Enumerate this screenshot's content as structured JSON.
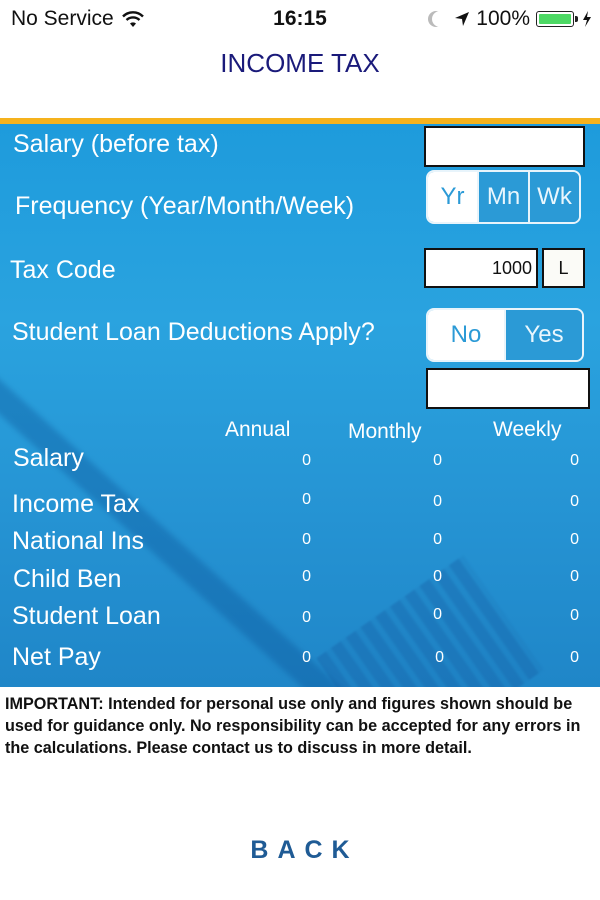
{
  "status_bar": {
    "carrier": "No Service",
    "time": "16:15",
    "battery_percent": "100%",
    "icons": [
      "wifi-icon",
      "moon-icon",
      "location-arrow-icon",
      "battery-icon",
      "charging-bolt-icon"
    ]
  },
  "header": {
    "title": "INCOME TAX"
  },
  "form": {
    "salary_label": "Salary (before tax)",
    "salary_value": "",
    "frequency_label": "Frequency (Year/Month/Week)",
    "frequency_options": [
      "Yr",
      "Mn",
      "Wk"
    ],
    "frequency_selected": "Yr",
    "tax_code_label": "Tax Code",
    "tax_code_value": "1000",
    "tax_code_suffix": "L",
    "student_loan_label": "Student Loan Deductions Apply?",
    "student_loan_options": [
      "No",
      "Yes"
    ],
    "student_loan_selected": "No",
    "student_loan_input_value": ""
  },
  "results": {
    "columns": [
      "Annual",
      "Monthly",
      "Weekly"
    ],
    "rows": [
      {
        "label": "Salary",
        "values": [
          "0",
          "0",
          "0"
        ]
      },
      {
        "label": "Income Tax",
        "values": [
          "0",
          "0",
          "0"
        ]
      },
      {
        "label": "National Ins",
        "values": [
          "0",
          "0",
          "0"
        ]
      },
      {
        "label": "Child Ben",
        "values": [
          "0",
          "0",
          "0"
        ]
      },
      {
        "label": "Student Loan",
        "values": [
          "0",
          "0",
          "0"
        ]
      },
      {
        "label": "Net Pay",
        "values": [
          "0",
          "0",
          "0"
        ]
      }
    ]
  },
  "disclaimer": "IMPORTANT: Intended for personal use only and figures shown should be used for guidance only. No responsibility can be accepted for any errors in the calculations. Please contact us to discuss in more detail.",
  "footer": {
    "back_label": "BACK"
  },
  "colors": {
    "accent_orange": "#f5b21d",
    "panel_blue": "#2aa3df",
    "title_navy": "#1a1a7a",
    "back_blue": "#1f5b95",
    "battery_green": "#4cd964"
  }
}
